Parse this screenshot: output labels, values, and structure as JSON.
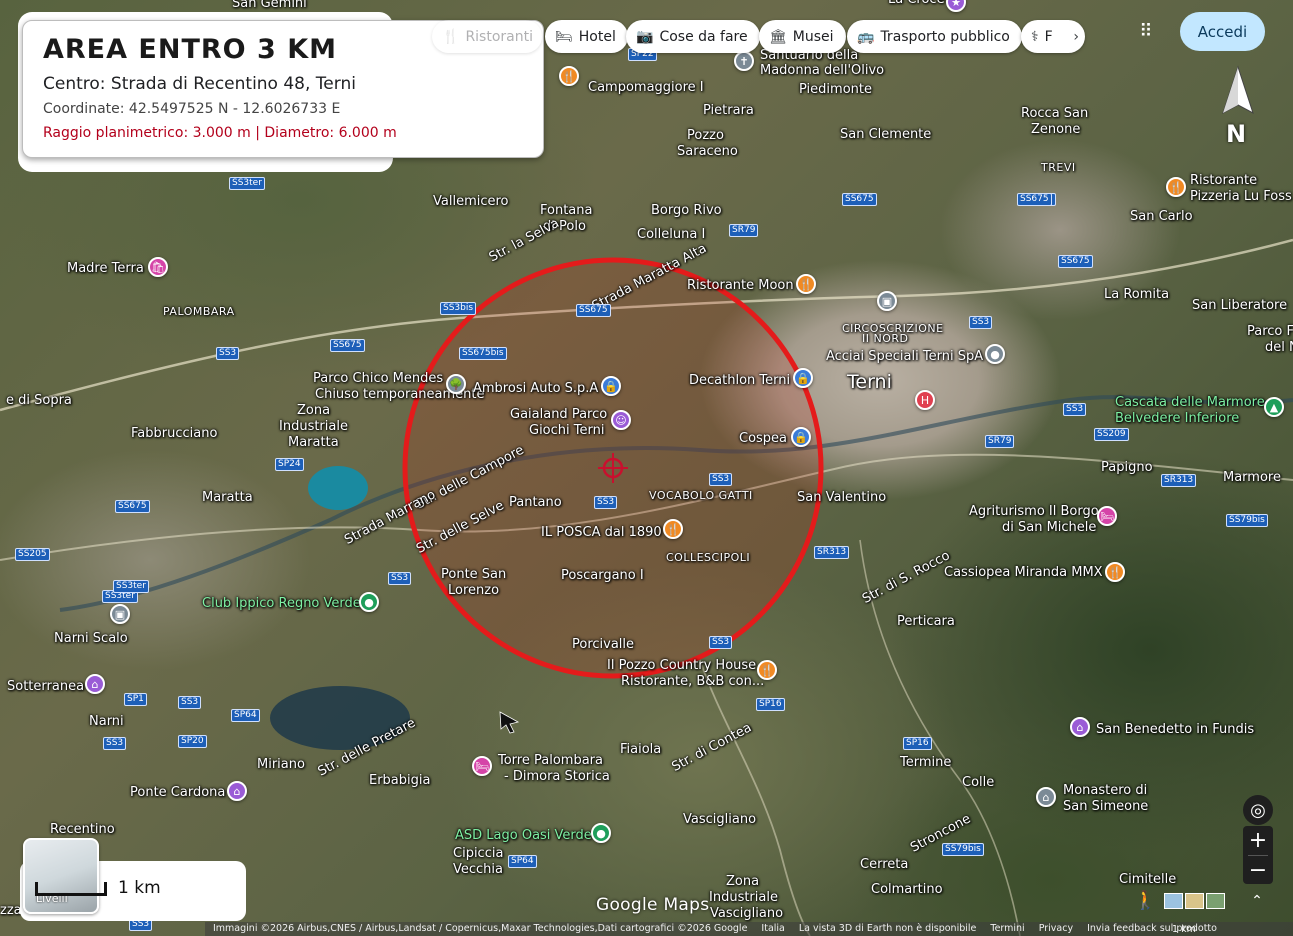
{
  "card": {
    "title": "AREA ENTRO 3 KM",
    "center": "Centro: Strada di Recentino 48, Terni",
    "coords": "Coordinate: 42.5497525 N - 12.6026733 E",
    "radius": "Raggio planimetrico: 3.000 m  |  Diametro: 6.000 m"
  },
  "chips": [
    {
      "label": "Ristoranti",
      "icon": "fork-knife-icon"
    },
    {
      "label": "Hotel",
      "icon": "bed-icon"
    },
    {
      "label": "Cose da fare",
      "icon": "camera-icon"
    },
    {
      "label": "Musei",
      "icon": "museum-icon"
    },
    {
      "label": "Trasporto pubblico",
      "icon": "bus-icon"
    },
    {
      "label": "F",
      "icon": "pharmacy-icon"
    }
  ],
  "header": {
    "signin": "Accedi"
  },
  "compass": {
    "label": "N"
  },
  "scale": {
    "label": "1 km",
    "layers": "Livelli",
    "footer_scale": "1 km"
  },
  "logo": "Google Maps",
  "footer": [
    "Immagini ©2026 Airbus,CNES / Airbus,Landsat / Copernicus,Maxar Technologies,Dati cartografici ©2026 Google",
    "Italia",
    "La vista 3D di Earth non è disponibile",
    "Termini",
    "Privacy",
    "Invia feedback sul prodotto"
  ],
  "circle": {
    "radius_m": 3000,
    "color": "#e41b1b"
  },
  "places": [
    {
      "t": "San Gemini",
      "c": ""
    },
    {
      "t": "La Croce",
      "c": ""
    },
    {
      "t": "Santuario della",
      "c": ""
    },
    {
      "t": "Madonna dell'Olivo",
      "c": ""
    },
    {
      "t": "Piedimonte",
      "c": ""
    },
    {
      "t": "Campomaggiore I",
      "c": ""
    },
    {
      "t": "Pietrara",
      "c": ""
    },
    {
      "t": "Pozzo",
      "c": ""
    },
    {
      "t": "Saraceno",
      "c": ""
    },
    {
      "t": "San Clemente",
      "c": ""
    },
    {
      "t": "Rocca San",
      "c": ""
    },
    {
      "t": "Zenone",
      "c": ""
    },
    {
      "t": "TREVI",
      "c": "small"
    },
    {
      "t": "Ristorante",
      "c": ""
    },
    {
      "t": "Pizzeria Lu Foss",
      "c": ""
    },
    {
      "t": "San Carlo",
      "c": ""
    },
    {
      "t": "Vallemicero",
      "c": ""
    },
    {
      "t": "Fontana",
      "c": ""
    },
    {
      "t": "di Polo",
      "c": ""
    },
    {
      "t": "Borgo Rivo",
      "c": ""
    },
    {
      "t": "Colleluna I",
      "c": ""
    },
    {
      "t": "Madre Terra",
      "c": ""
    },
    {
      "t": "PALOMBARA",
      "c": "small"
    },
    {
      "t": "Str. la Selva",
      "c": ""
    },
    {
      "t": "Strada Maratta Alta",
      "c": ""
    },
    {
      "t": "Ristorante Moon",
      "c": ""
    },
    {
      "t": "La Romita",
      "c": ""
    },
    {
      "t": "San Liberatore",
      "c": ""
    },
    {
      "t": "Parco F",
      "c": ""
    },
    {
      "t": "del N",
      "c": ""
    },
    {
      "t": "CIRCOSCRIZIONE",
      "c": "small"
    },
    {
      "t": "II NORD",
      "c": "small"
    },
    {
      "t": "Acciai Speciali Terni SpA",
      "c": ""
    },
    {
      "t": "Terni",
      "c": "big"
    },
    {
      "t": "Parco Chico Mendes",
      "c": ""
    },
    {
      "t": "Chiuso temporaneamente",
      "c": ""
    },
    {
      "t": "Ambrosi Auto S.p.A",
      "c": ""
    },
    {
      "t": "Decathlon Terni",
      "c": ""
    },
    {
      "t": "Gaialand Parco",
      "c": ""
    },
    {
      "t": "Giochi Terni",
      "c": ""
    },
    {
      "t": "Cascata delle Marmore",
      "c": "green"
    },
    {
      "t": "Belvedere Inferiore",
      "c": "green"
    },
    {
      "t": "e di Sopra",
      "c": ""
    },
    {
      "t": "Zona",
      "c": ""
    },
    {
      "t": "Industriale",
      "c": ""
    },
    {
      "t": "Maratta",
      "c": ""
    },
    {
      "t": "Fabbrucciano",
      "c": ""
    },
    {
      "t": "Cospea",
      "c": ""
    },
    {
      "t": "Papigno",
      "c": ""
    },
    {
      "t": "Marmore",
      "c": ""
    },
    {
      "t": "Str. delle Campore",
      "c": ""
    },
    {
      "t": "Maratta",
      "c": ""
    },
    {
      "t": "Pantano",
      "c": ""
    },
    {
      "t": "VOCABOLO GATTI",
      "c": "small"
    },
    {
      "t": "San Valentino",
      "c": ""
    },
    {
      "t": "Agriturismo Il Borgo",
      "c": ""
    },
    {
      "t": "di San Michele",
      "c": ""
    },
    {
      "t": "Strada Marrano",
      "c": ""
    },
    {
      "t": "IL POSCA dal 1890",
      "c": ""
    },
    {
      "t": "COLLESCIPOLI",
      "c": "small"
    },
    {
      "t": "Cassiopea Miranda MMX",
      "c": ""
    },
    {
      "t": "Str. delle Selve",
      "c": ""
    },
    {
      "t": "Ponte San",
      "c": ""
    },
    {
      "t": "Lorenzo",
      "c": ""
    },
    {
      "t": "Poscargano I",
      "c": ""
    },
    {
      "t": "Str. di S. Rocco",
      "c": ""
    },
    {
      "t": "Club Ippico Regno Verde",
      "c": "green"
    },
    {
      "t": "Perticara",
      "c": ""
    },
    {
      "t": "Narni Scalo",
      "c": ""
    },
    {
      "t": "Porcivalle",
      "c": ""
    },
    {
      "t": "Il Pozzo Country House",
      "c": ""
    },
    {
      "t": "Ristorante, B&B con...",
      "c": ""
    },
    {
      "t": "Sotterranea",
      "c": ""
    },
    {
      "t": "Narni",
      "c": ""
    },
    {
      "t": "San Benedetto in Fundis",
      "c": ""
    },
    {
      "t": "Str. delle Pretare",
      "c": ""
    },
    {
      "t": "Str. di Contea",
      "c": ""
    },
    {
      "t": "Fiaiola",
      "c": ""
    },
    {
      "t": "Torre Palombara",
      "c": ""
    },
    {
      "t": "- Dimora Storica",
      "c": ""
    },
    {
      "t": "Termine",
      "c": ""
    },
    {
      "t": "Miriano",
      "c": ""
    },
    {
      "t": "Erbabigia",
      "c": ""
    },
    {
      "t": "Colle",
      "c": ""
    },
    {
      "t": "Monastero di",
      "c": ""
    },
    {
      "t": "San Simeone",
      "c": ""
    },
    {
      "t": "Ponte Cardona",
      "c": ""
    },
    {
      "t": "Vasciglianо",
      "c": ""
    },
    {
      "t": "Recentino",
      "c": ""
    },
    {
      "t": "ASD Lago Oasi Verde",
      "c": "green"
    },
    {
      "t": "Cipiccia",
      "c": ""
    },
    {
      "t": "Vecchia",
      "c": ""
    },
    {
      "t": "Stroncone",
      "c": ""
    },
    {
      "t": "Cerreta",
      "c": ""
    },
    {
      "t": "Colmartino",
      "c": ""
    },
    {
      "t": "Cimitelle",
      "c": ""
    },
    {
      "t": "Zona",
      "c": ""
    },
    {
      "t": "Industriale",
      "c": ""
    },
    {
      "t": "Vascigliano",
      "c": ""
    },
    {
      "t": "Terni",
      "c": ""
    },
    {
      "t": "zza",
      "c": ""
    }
  ],
  "roads": [
    "SP22",
    "SS3ter",
    "SS675",
    "SS3bis",
    "SS675bis",
    "SS3ter",
    "SS675",
    "SP24",
    "SS675",
    "SS205",
    "SS3ter",
    "SS3",
    "SP1",
    "SS3",
    "SP64",
    "SP20",
    "SS3",
    "SS675",
    "SS3",
    "SS3",
    "SS675",
    "SR79",
    "SS3",
    "SS209",
    "SR79",
    "SR313",
    "SR313",
    "SP16",
    "SP16",
    "SS79bis",
    "SS675",
    "SS79bis",
    "SS3",
    "SS3",
    "SP64",
    "SS3",
    "SS3",
    "SS675"
  ]
}
